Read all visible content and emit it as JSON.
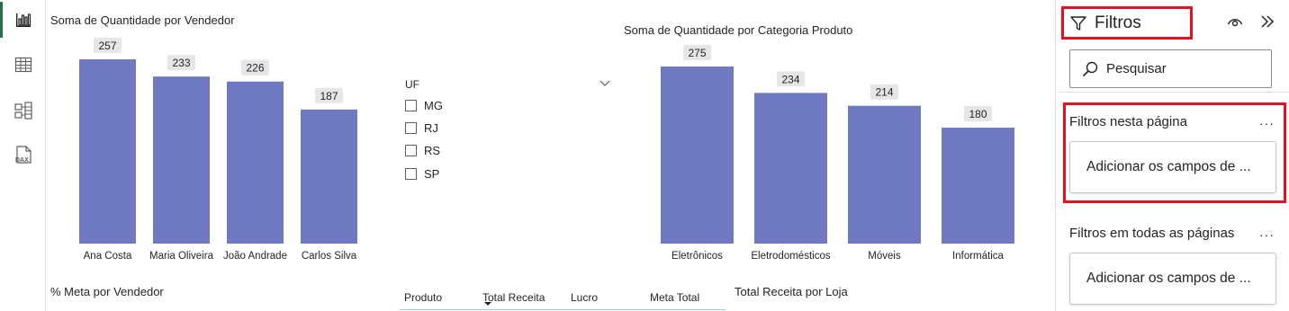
{
  "rail": {
    "items": [
      {
        "icon": "report-view-icon",
        "active": true
      },
      {
        "icon": "table-view-icon",
        "active": false
      },
      {
        "icon": "model-view-icon",
        "active": false
      },
      {
        "icon": "dax-query-icon",
        "label": "DAX",
        "active": false
      }
    ]
  },
  "chart_vendedor": {
    "title": "Soma de Quantidade por Vendedor",
    "chart_data": {
      "type": "bar",
      "categories": [
        "Ana Costa",
        "Maria Oliveira",
        "João Andrade",
        "Carlos Silva"
      ],
      "values": [
        257,
        233,
        226,
        187
      ],
      "color": "#6f79c2"
    }
  },
  "chart_categoria": {
    "title": "Soma de Quantidade por Categoria Produto",
    "chart_data": {
      "type": "bar",
      "categories": [
        "Eletrônicos",
        "Eletrodomésticos",
        "Móveis",
        "Informática"
      ],
      "values": [
        275,
        234,
        214,
        180
      ],
      "color": "#6f79c2"
    }
  },
  "slicer": {
    "title": "UF",
    "items": [
      "MG",
      "RJ",
      "RS",
      "SP"
    ]
  },
  "meta_title": "% Meta por Vendedor",
  "loja_title": "Total Receita por Loja",
  "table": {
    "columns": [
      "Produto",
      "Total Receita",
      "Lucro",
      "Meta Total"
    ]
  },
  "filters": {
    "title": "Filtros",
    "search_label": "Pesquisar",
    "page_section": "Filtros nesta página",
    "page_well": "Adicionar os campos de ...",
    "all_section": "Filtros em todas as páginas",
    "all_well": "Adicionar os campos de ...",
    "more": "···"
  },
  "colors": {
    "bar": "#6f79c2",
    "highlight": "#e8101e",
    "active_rail": "#217346"
  }
}
